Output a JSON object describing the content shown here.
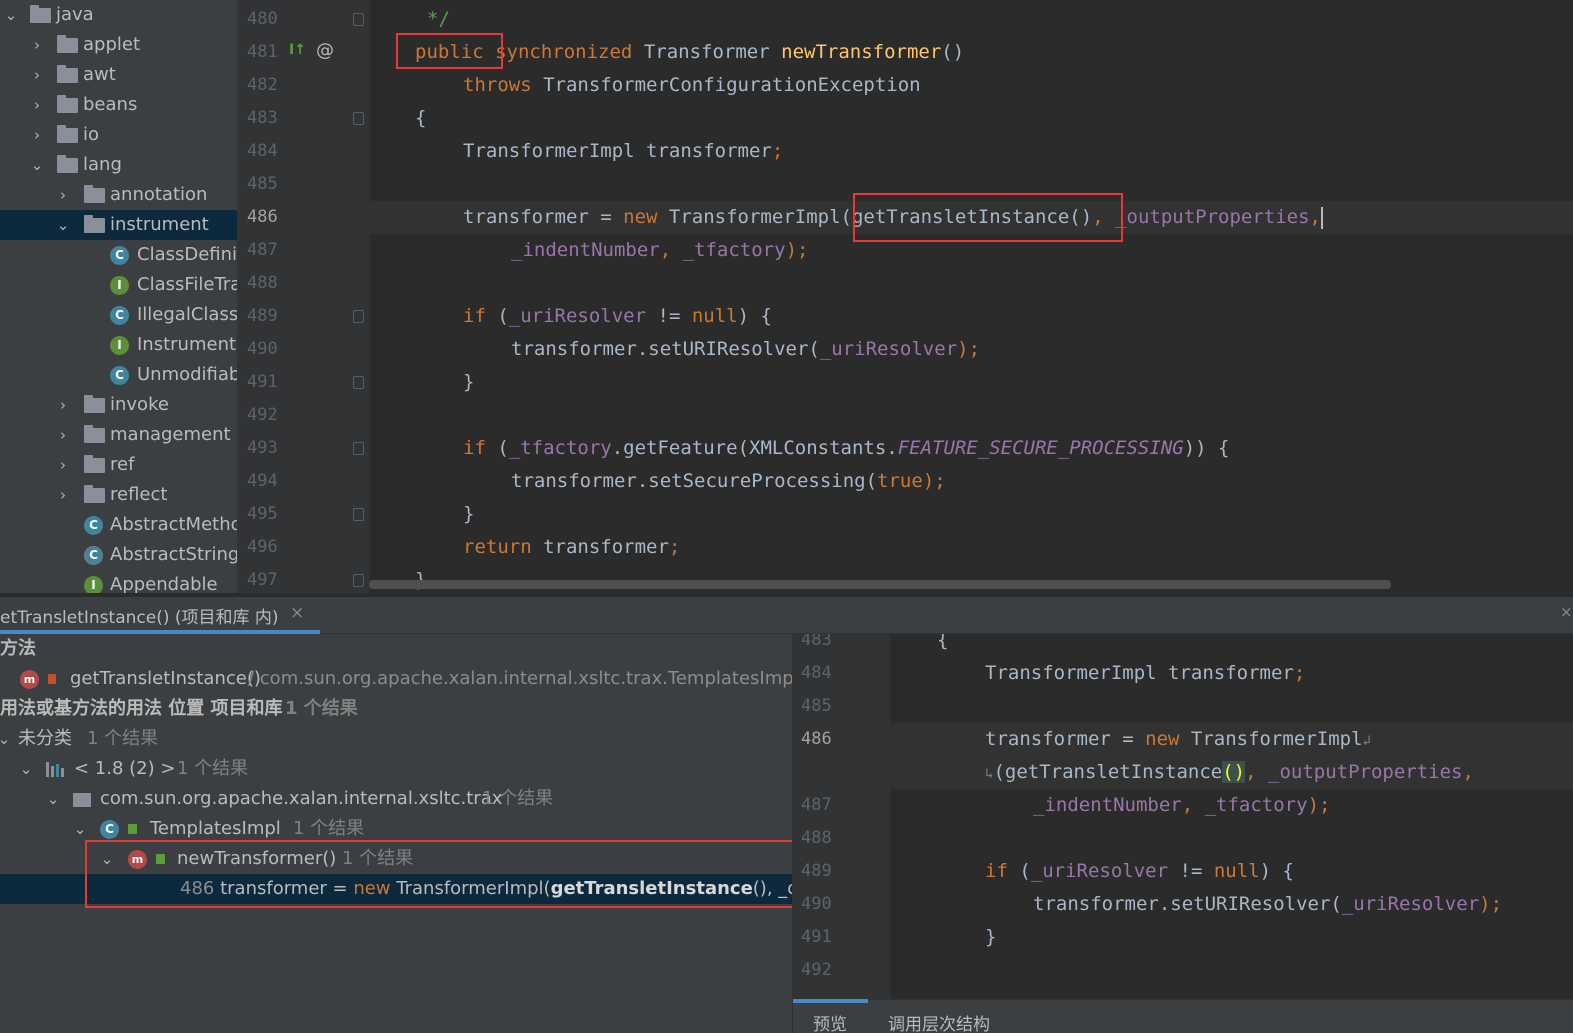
{
  "project_tree": {
    "items": [
      {
        "label": "java",
        "type": "folder",
        "expanded": true
      },
      {
        "label": "applet",
        "type": "folder",
        "expanded": false
      },
      {
        "label": "awt",
        "type": "folder",
        "expanded": false
      },
      {
        "label": "beans",
        "type": "folder",
        "expanded": false
      },
      {
        "label": "io",
        "type": "folder",
        "expanded": false
      },
      {
        "label": "lang",
        "type": "folder",
        "expanded": true
      },
      {
        "label": "annotation",
        "type": "folder",
        "expanded": false
      },
      {
        "label": "instrument",
        "type": "folder",
        "expanded": true,
        "selected": true
      },
      {
        "label": "ClassDefinit",
        "type": "class"
      },
      {
        "label": "ClassFileTra",
        "type": "interface"
      },
      {
        "label": "IllegalClassF",
        "type": "class"
      },
      {
        "label": "Instrumenta",
        "type": "interface"
      },
      {
        "label": "Unmodifiab",
        "type": "class"
      },
      {
        "label": "invoke",
        "type": "folder",
        "expanded": false
      },
      {
        "label": "management",
        "type": "folder",
        "expanded": false
      },
      {
        "label": "ref",
        "type": "folder",
        "expanded": false
      },
      {
        "label": "reflect",
        "type": "folder",
        "expanded": false
      },
      {
        "label": "AbstractMetho",
        "type": "class"
      },
      {
        "label": "AbstractString",
        "type": "abstract-class"
      },
      {
        "label": "Appendable",
        "type": "interface"
      }
    ],
    "icon_glyphs": {
      "class": "C",
      "interface": "I",
      "abstract-class": "C"
    }
  },
  "editor": {
    "line_numbers": [
      "480",
      "481",
      "482",
      "483",
      "484",
      "485",
      "486",
      "487",
      "488",
      "489",
      "490",
      "491",
      "492",
      "493",
      "494",
      "495",
      "496",
      "497"
    ],
    "current_line": "486",
    "gutter_marks": {
      "override": "I↑",
      "annotation": "@",
      "bulb": "bulb-icon"
    },
    "lines": {
      "l480": "*/",
      "l481_public": "public",
      "l481_sync": "synchronized",
      "l481_type": "Transformer",
      "l481_name": "newTransformer",
      "l481_paren": "()",
      "l482_throws": "throws",
      "l482_exc": "TransformerConfigurationException",
      "l483": "{",
      "l484_decl": "TransformerImpl transformer",
      "l484_semi": ";",
      "l486_lhs": "transformer = ",
      "l486_new": "new",
      "l486_ctor": " TransformerImpl",
      "l486_call": "(getTransletInstance()",
      "l486_comma": ", ",
      "l486_field": "_outputProperties",
      "l486_comma2": ",",
      "l487_f1": "_indentNumber",
      "l487_comma": ", ",
      "l487_f2": "_tfactory",
      "l487_end": ");",
      "l489_if": "if",
      "l489_open": " (",
      "l489_field": "_uriResolver",
      "l489_ne": " != ",
      "l489_null": "null",
      "l489_close": ") {",
      "l490_call": "transformer.setURIResolver(",
      "l490_field": "_uriResolver",
      "l490_end": ");",
      "l491": "}",
      "l493_if": "if",
      "l493_open": " (",
      "l493_field": "_tfactory",
      "l493_mid": ".getFeature(XMLConstants.",
      "l493_const": "FEATURE_SECURE_PROCESSING",
      "l493_close": ")) {",
      "l494_call": "transformer.setSecureProcessing(",
      "l494_true": "true",
      "l494_end": ");",
      "l495": "}",
      "l496_return": "return",
      "l496_rest": " transformer",
      "l496_semi": ";",
      "l497": "}"
    }
  },
  "find_panel": {
    "tab_title": "etTransletInstance() (项目和库 内)",
    "close_glyph": "×",
    "dock_close": "×",
    "rows": {
      "r1_label": "方法",
      "r2_method": "getTransletInstance()",
      "r2_path": " / com.sun.org.apache.xalan.internal.xsltc.trax.TemplatesImpl",
      "r3_label": "用法或基方法的用法 位置 项目和库",
      "r3_count": "1 个结果",
      "r4_label": "未分类",
      "r4_count": "1 个结果",
      "r5_label": "< 1.8 (2) >",
      "r5_count": "1 个结果",
      "r6_label": "com.sun.org.apache.xalan.internal.xsltc.trax",
      "r6_count": "1 个结果",
      "r7_label": "TemplatesImpl",
      "r7_count": "1 个结果",
      "r8_label": "newTransformer()",
      "r8_count": "1 个结果",
      "r9_linenum": "486",
      "r9_pre": " transformer = ",
      "r9_new": "new",
      "r9_ctor": " TransformerImpl(",
      "r9_match": "getTransletInstance",
      "r9_post": "(), _output"
    }
  },
  "preview": {
    "line_numbers": {
      "p483": "483",
      "p484": "484",
      "p485": "485",
      "p486": "486",
      "p487": "487",
      "p488": "488",
      "p489": "489",
      "p490": "490",
      "p491": "491",
      "p492": "492"
    },
    "lines": {
      "p483": "{",
      "p484_decl": "TransformerImpl transformer",
      "p484_semi": ";",
      "p486_lhs": "transformer = ",
      "p486_new": "new",
      "p486_ctor": " TransformerImpl",
      "p486_wrap": "↲",
      "p486b_wrap": "↳",
      "p486b_call": "(getTransletInstance",
      "p486b_paren": "()",
      "p486b_comma": ", ",
      "p486b_field": "_outputProperties",
      "p486b_comma2": ",",
      "p487_f1": "_indentNumber",
      "p487_comma": ", ",
      "p487_f2": "_tfactory",
      "p487_end": ");",
      "p489_if": "if",
      "p489_open": " (",
      "p489_field": "_uriResolver",
      "p489_ne": " != ",
      "p489_null": "null",
      "p489_close": ") {",
      "p490_call": "transformer.setURIResolver(",
      "p490_field": "_uriResolver",
      "p490_end": ");",
      "p491": "}"
    },
    "tabs": [
      "预览",
      "调用层次结构"
    ]
  },
  "colors": {
    "keyword": "#cc7832",
    "function": "#ffc66d",
    "field": "#9876aa",
    "comment": "#629755",
    "plain": "#a9b7c6",
    "highlight_box": "#e53935",
    "selection": "#0d293e"
  }
}
